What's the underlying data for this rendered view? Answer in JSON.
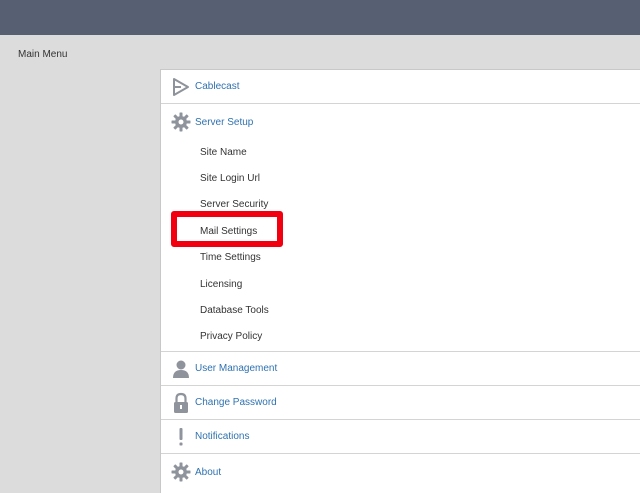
{
  "header": {
    "main_menu_label": "Main Menu"
  },
  "menu": {
    "sections": {
      "cablecast": {
        "label": "Cablecast",
        "icon": "cablecast-logo-icon"
      },
      "server_setup": {
        "label": "Server Setup",
        "icon": "gear-icon",
        "items": [
          "Site Name",
          "Site Login Url",
          "Server Security",
          "Mail Settings",
          "Time Settings",
          "Licensing",
          "Database Tools",
          "Privacy Policy"
        ]
      },
      "user_management": {
        "label": "User Management",
        "icon": "user-icon"
      },
      "change_password": {
        "label": "Change Password",
        "icon": "lock-icon"
      },
      "notifications": {
        "label": "Notifications",
        "icon": "exclamation-icon"
      },
      "about": {
        "label": "About",
        "icon": "gear-icon"
      }
    }
  },
  "highlight": {
    "target": "Mail Settings",
    "color": "#f2000f"
  },
  "colors": {
    "topbar": "#575f72",
    "link": "#2f72b0",
    "icon": "#8e939c",
    "background": "#dcdcdc"
  }
}
